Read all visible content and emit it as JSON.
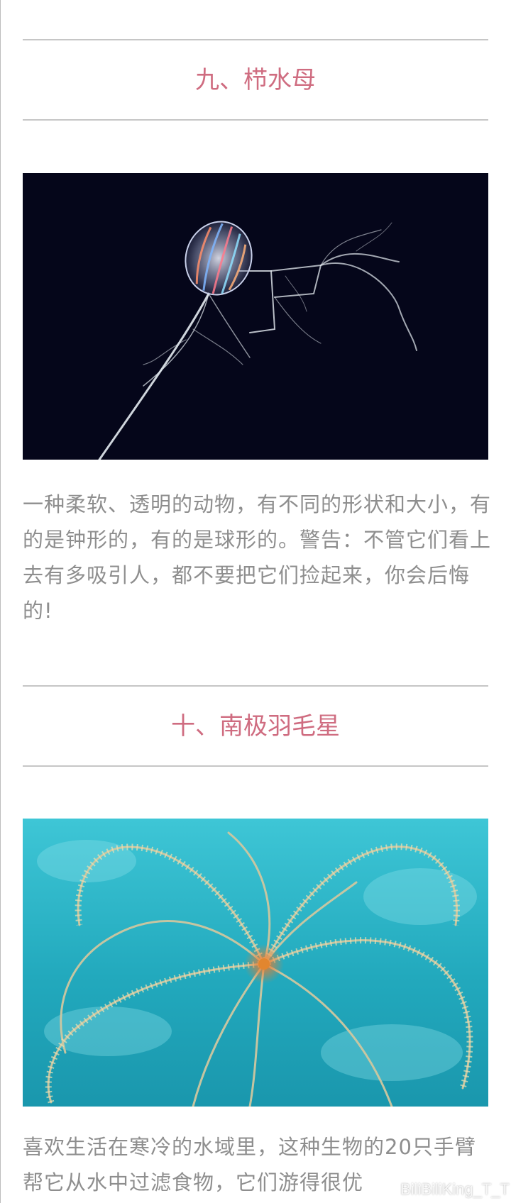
{
  "sections": [
    {
      "heading": "九、栉水母",
      "image_subject": "comb jellyfish (ctenophore) on dark background",
      "text": "一种柔软、透明的动物，有不同的形状和大小，有的是钟形的，有的是球形的。警告：不管它们看上去有多吸引人，都不要把它们捡起来，你会后悔的!"
    },
    {
      "heading": "十、南极羽毛星",
      "image_subject": "Antarctic feather star with feathery arms on blue water",
      "text": "喜欢生活在寒冷的水域里，这种生物的20只手臂帮它从水中过滤食物，它们游得很优"
    }
  ],
  "watermark": "BiliBiliKing_T_T",
  "colors": {
    "heading": "#cf6c80",
    "body_text": "#8e8e8e",
    "rule": "#c6c6c6"
  }
}
